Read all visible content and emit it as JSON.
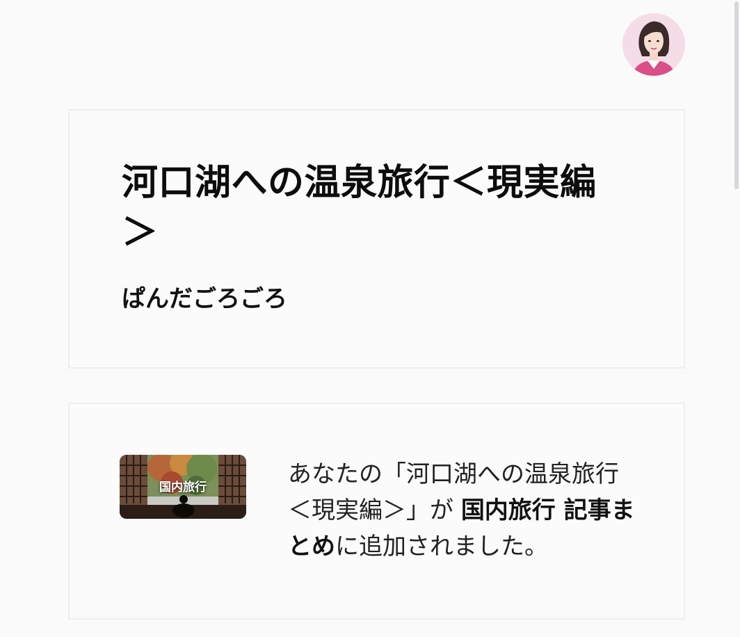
{
  "header": {
    "avatar_icon": "user-avatar-icon"
  },
  "article": {
    "title": "河口湖への温泉旅行＜現実編＞",
    "author": "ぱんだごろごろ"
  },
  "notice": {
    "thumbnail_label": "国内旅行",
    "text_prefix": "あなたの「河口湖への温泉旅行＜現実編＞」が ",
    "magazine_link": "国内旅行 記事まとめ",
    "text_suffix": "に追加されました。"
  },
  "colors": {
    "background": "#fafafb",
    "card_border": "#efeff1",
    "avatar_bg": "#f5dde7",
    "avatar_accent": "#d94f86"
  }
}
